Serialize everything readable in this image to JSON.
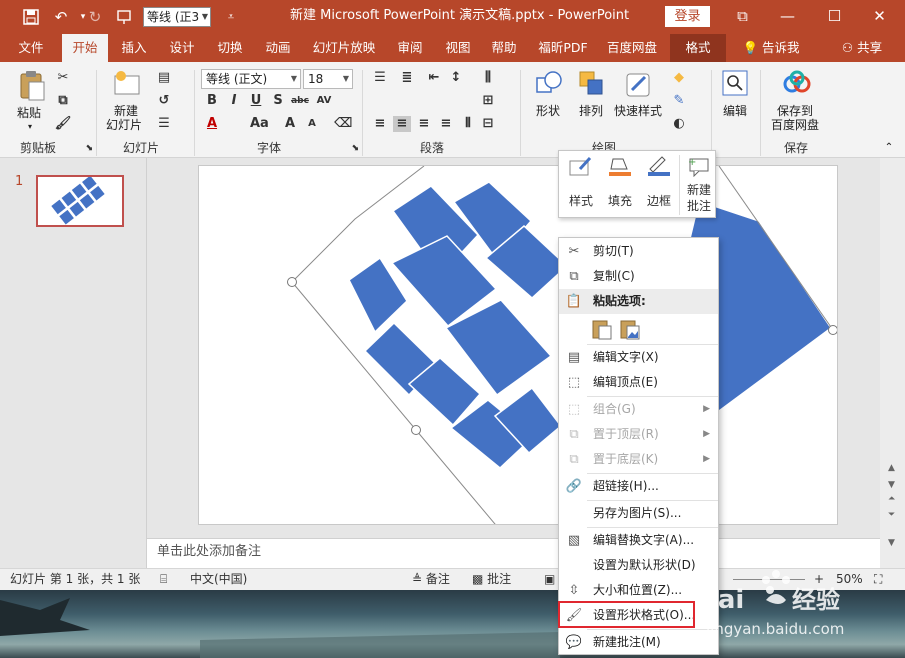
{
  "title_bar": {
    "font_name": "等线 (正3",
    "doc_title": "新建 Microsoft PowerPoint 演示文稿.pptx  -  PowerPoint",
    "login": "登录",
    "icons": [
      "save-icon",
      "undo-icon",
      "redo-icon",
      "present-icon",
      "customize-icon",
      "ribbon-display-icon",
      "minimize-icon",
      "maximize-icon",
      "close-icon"
    ]
  },
  "tabs": [
    {
      "label": "文件"
    },
    {
      "label": "开始"
    },
    {
      "label": "插入"
    },
    {
      "label": "设计"
    },
    {
      "label": "切换"
    },
    {
      "label": "动画"
    },
    {
      "label": "幻灯片放映"
    },
    {
      "label": "审阅"
    },
    {
      "label": "视图"
    },
    {
      "label": "帮助"
    },
    {
      "label": "福昕PDF"
    },
    {
      "label": "百度网盘"
    },
    {
      "label": "格式"
    }
  ],
  "tell_me": "告诉我",
  "share": "共享",
  "ribbon": {
    "clipboard": {
      "label": "剪贴板",
      "paste": "粘贴"
    },
    "slides": {
      "label": "幻灯片",
      "new_slide_1": "新建",
      "new_slide_2": "幻灯片"
    },
    "font": {
      "label": "字体",
      "font_name": "等线 (正文)",
      "font_size": "18"
    },
    "paragraph": {
      "label": "段落"
    },
    "drawing": {
      "label": "绘图",
      "shape": "形状",
      "arrange": "排列",
      "quick_styles": "快速样式"
    },
    "editing": {
      "label": "编辑"
    },
    "save": {
      "label": "保存",
      "save_to_1": "保存到",
      "save_to_2": "百度网盘"
    }
  },
  "slide_panel": {
    "number": "1"
  },
  "notes_placeholder": "单击此处添加备注",
  "status_bar": {
    "slide_info": "幻灯片 第 1 张，共 1 张",
    "language": "中文(中国)",
    "notes": "备注",
    "comments": "批注",
    "zoom": "50%"
  },
  "mini_toolbar": {
    "style": "样式",
    "fill": "填充",
    "outline": "边框",
    "new_comment_1": "新建",
    "new_comment_2": "批注"
  },
  "context_menu": [
    {
      "label": "剪切(T)",
      "icon": "scissors-icon",
      "disabled": false
    },
    {
      "label": "复制(C)",
      "icon": "copy-icon",
      "disabled": false
    },
    {
      "label": "粘贴选项:",
      "icon": "paste-icon",
      "disabled": false
    },
    {
      "label": "编辑文字(X)",
      "icon": "edit-text-icon",
      "disabled": false
    },
    {
      "label": "编辑顶点(E)",
      "icon": "edit-points-icon",
      "disabled": false
    },
    {
      "label": "组合(G)",
      "icon": "group-icon",
      "disabled": true
    },
    {
      "label": "置于顶层(R)",
      "icon": "bring-front-icon",
      "disabled": true
    },
    {
      "label": "置于底层(K)",
      "icon": "send-back-icon",
      "disabled": true
    },
    {
      "label": "超链接(H)...",
      "icon": "link-icon",
      "disabled": false
    },
    {
      "label": "另存为图片(S)...",
      "icon": "",
      "disabled": false
    },
    {
      "label": "编辑替换文字(A)...",
      "icon": "alt-text-icon",
      "disabled": false
    },
    {
      "label": "设置为默认形状(D)",
      "icon": "",
      "disabled": false
    },
    {
      "label": "大小和位置(Z)...",
      "icon": "size-position-icon",
      "disabled": false
    },
    {
      "label": "设置形状格式(O)...",
      "icon": "format-shape-icon",
      "disabled": false
    },
    {
      "label": "新建批注(M)",
      "icon": "comment-icon",
      "disabled": false
    }
  ],
  "watermark": {
    "brand": "Bai",
    "brand2": "经验",
    "url": "jingyan.baidu.com"
  },
  "colors": {
    "accent": "#b7472a",
    "shape": "#4472c4",
    "highlight": "#e0272f"
  }
}
